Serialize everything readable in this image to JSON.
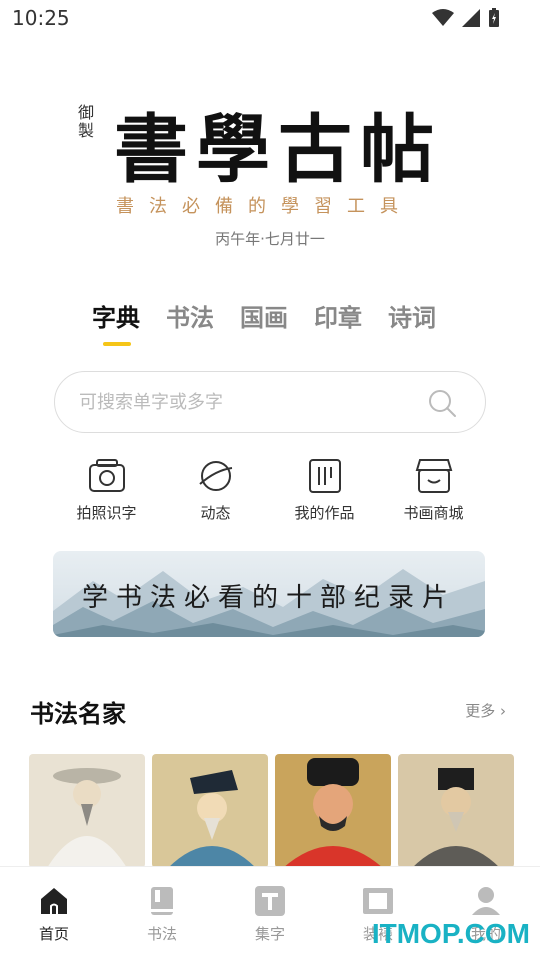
{
  "status_bar": {
    "time": "10:25"
  },
  "logo": {
    "seal_text": "御製",
    "title": "書學古帖",
    "slogan": "書法必備的學習工具"
  },
  "lunar_date": "丙午年·七月廿一",
  "tabs": [
    {
      "label": "字典",
      "active": true
    },
    {
      "label": "书法",
      "active": false
    },
    {
      "label": "国画",
      "active": false
    },
    {
      "label": "印章",
      "active": false
    },
    {
      "label": "诗词",
      "active": false
    }
  ],
  "search": {
    "placeholder": "可搜索单字或多字"
  },
  "actions": [
    {
      "label": "拍照识字",
      "icon": "camera-icon"
    },
    {
      "label": "动态",
      "icon": "planet-icon"
    },
    {
      "label": "我的作品",
      "icon": "works-icon"
    },
    {
      "label": "书画商城",
      "icon": "shop-icon"
    }
  ],
  "banner": {
    "text": "学书法必看的十部纪录片"
  },
  "section": {
    "title": "书法名家",
    "more_label": "更多 ›"
  },
  "bottom_nav": [
    {
      "label": "首页",
      "icon": "home-icon",
      "active": true
    },
    {
      "label": "书法",
      "icon": "book-icon",
      "active": false
    },
    {
      "label": "集字",
      "icon": "text-icon",
      "active": false
    },
    {
      "label": "装裱",
      "icon": "frame-icon",
      "active": false
    },
    {
      "label": "我的",
      "icon": "user-icon",
      "active": false
    }
  ],
  "watermark": "ITMOP.COM",
  "colors": {
    "accent": "#f5c518",
    "slogan": "#c5935c",
    "watermark": "#19b2c4"
  }
}
